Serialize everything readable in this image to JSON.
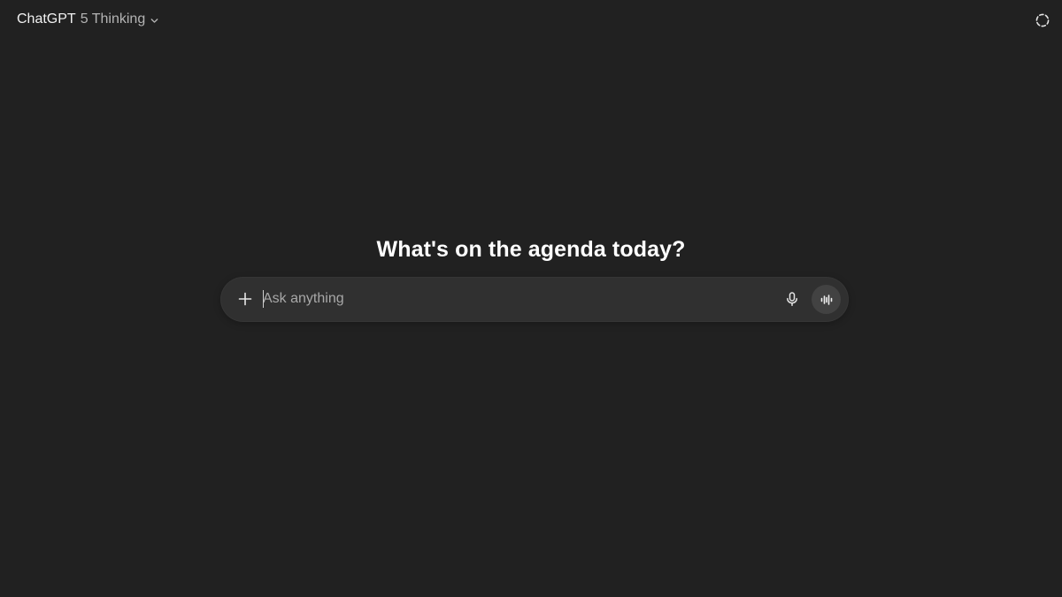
{
  "header": {
    "brand": "ChatGPT",
    "model": "5 Thinking",
    "chevron_icon": "chevron-down-icon",
    "temp_chat_icon": "dashed-circle-icon"
  },
  "main": {
    "headline": "What's on the agenda today?"
  },
  "composer": {
    "placeholder": "Ask anything",
    "value": "",
    "add_icon": "plus-icon",
    "mic_icon": "microphone-icon",
    "voice_icon": "voice-mode-icon"
  },
  "colors": {
    "background": "#212121",
    "composer_bg": "#303030",
    "voice_button_bg": "#424242",
    "text_primary": "#ececec",
    "text_secondary": "#b4b4b4"
  }
}
